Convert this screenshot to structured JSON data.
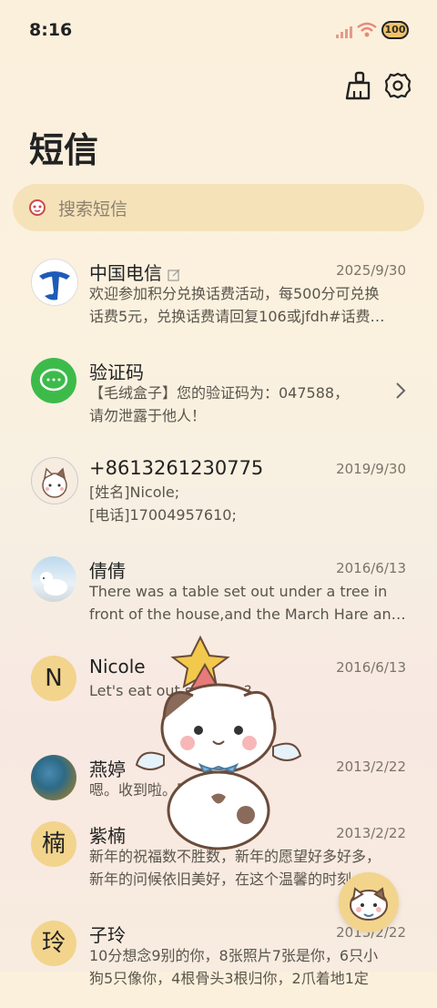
{
  "status": {
    "time": "8:16",
    "battery": "100"
  },
  "title": "短信",
  "search": {
    "placeholder": "搜索短信"
  },
  "messages": [
    {
      "name": "中国电信",
      "date": "2025/9/30",
      "lines": [
        "欢迎参加积分兑换话费活动，每500分可兑换",
        "话费5元，兑换话费请回复106或jfdh#话费…"
      ]
    },
    {
      "name": "验证码",
      "date": "",
      "lines": [
        "【毛绒盒子】您的验证码为：047588，",
        "请勿泄露于他人！"
      ]
    },
    {
      "name": "+8613261230775",
      "date": "2019/9/30",
      "lines": [
        "[姓名]Nicole;",
        "[电话]17004957610;"
      ]
    },
    {
      "name": "倩倩",
      "date": "2016/6/13",
      "lines": [
        "There was a table set out under a tree in",
        "front of the house,and the March Hare an…"
      ]
    },
    {
      "name": "Nicole",
      "date": "2016/6/13",
      "initial": "N",
      "lines": [
        "Let's eat out,shall we?"
      ]
    },
    {
      "name": "燕婷",
      "date": "2013/2/22",
      "lines": [
        "嗯。收到啦。同乐同乐。"
      ]
    },
    {
      "name": "紫楠",
      "date": "2013/2/22",
      "initial": "楠",
      "lines": [
        "新年的祝福数不胜数，新年的愿望好多好多，",
        "新年的问候依旧美好，在这个温馨的时刻，…"
      ]
    },
    {
      "name": "子玲",
      "date": "2013/2/22",
      "initial": "玲",
      "lines": [
        "10分想念9别的你，8张照片7张是你，6只小",
        "狗5只像你，4根骨头3根归你，2爪着地1定"
      ]
    }
  ],
  "icons": {
    "clean": "broom-icon",
    "settings": "gear-icon",
    "search": "search-icon",
    "compose": "compose-icon"
  },
  "colors": {
    "background": "#fbf0dc",
    "search_bg": "#f6e2b8",
    "avatar_bg": "#f2d48c",
    "telecom_blue": "#1e5bb8",
    "sms_green": "#3dbb4a"
  }
}
